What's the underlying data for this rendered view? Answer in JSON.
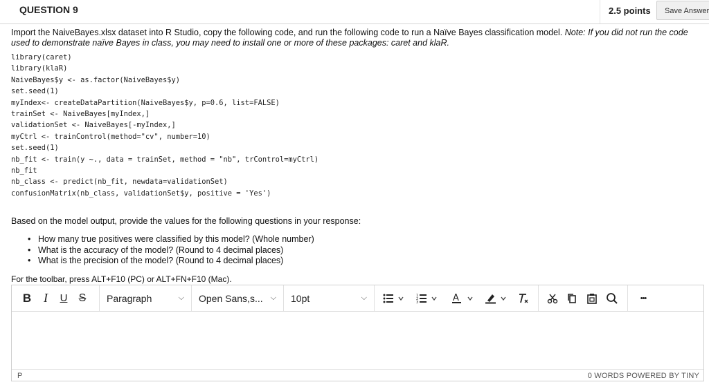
{
  "header": {
    "question_title": "QUESTION 9",
    "points": "2.5 points",
    "save_label": "Save Answer"
  },
  "question": {
    "text": "Import the NaiveBayes.xlsx dataset into R Studio, copy the following code, and run the following code to run a Naïve Bayes classification model. ",
    "note": "Note: If you did not run the code used to demonstrate naïve Bayes in class, you may need to install one or more of these packages: caret and klaR."
  },
  "code_lines": [
    "library(caret)",
    "library(klaR)",
    "NaiveBayes$y <- as.factor(NaiveBayes$y)",
    "set.seed(1)",
    "myIndex<- createDataPartition(NaiveBayes$y, p=0.6, list=FALSE)",
    "trainSet <- NaiveBayes[myIndex,]",
    "validationSet <- NaiveBayes[-myIndex,]",
    "myCtrl <- trainControl(method=\"cv\", number=10)",
    "set.seed(1)",
    "nb_fit <- train(y ~., data = trainSet, method = \"nb\", trControl=myCtrl)",
    "nb_fit",
    "nb_class <- predict(nb_fit, newdata=validationSet)",
    "confusionMatrix(nb_class, validationSet$y, positive = 'Yes')"
  ],
  "prompt": "Based on the model output, provide the values for the following questions in your response:",
  "bullets": [
    "How many true positives were classified by this model? (Whole number)",
    "What is the accuracy of the model? (Round to 4 decimal places)",
    "What is the precision of the model? (Round to 4 decimal places)"
  ],
  "toolbar_hint": "For the toolbar, press ALT+F10 (PC) or ALT+FN+F10 (Mac).",
  "editor": {
    "bold": "B",
    "italic": "I",
    "underline": "U",
    "strike": "S",
    "block_format": "Paragraph",
    "font_family": "Open Sans,s...",
    "font_size": "10pt",
    "more": "•••",
    "path": "P",
    "status": "0 WORDS  POWERED BY TINY"
  },
  "icons": [
    "bullet-list-icon",
    "numbered-list-icon",
    "text-color-icon",
    "highlight-icon",
    "clear-format-icon",
    "cut-icon",
    "copy-icon",
    "paste-icon",
    "search-icon"
  ]
}
